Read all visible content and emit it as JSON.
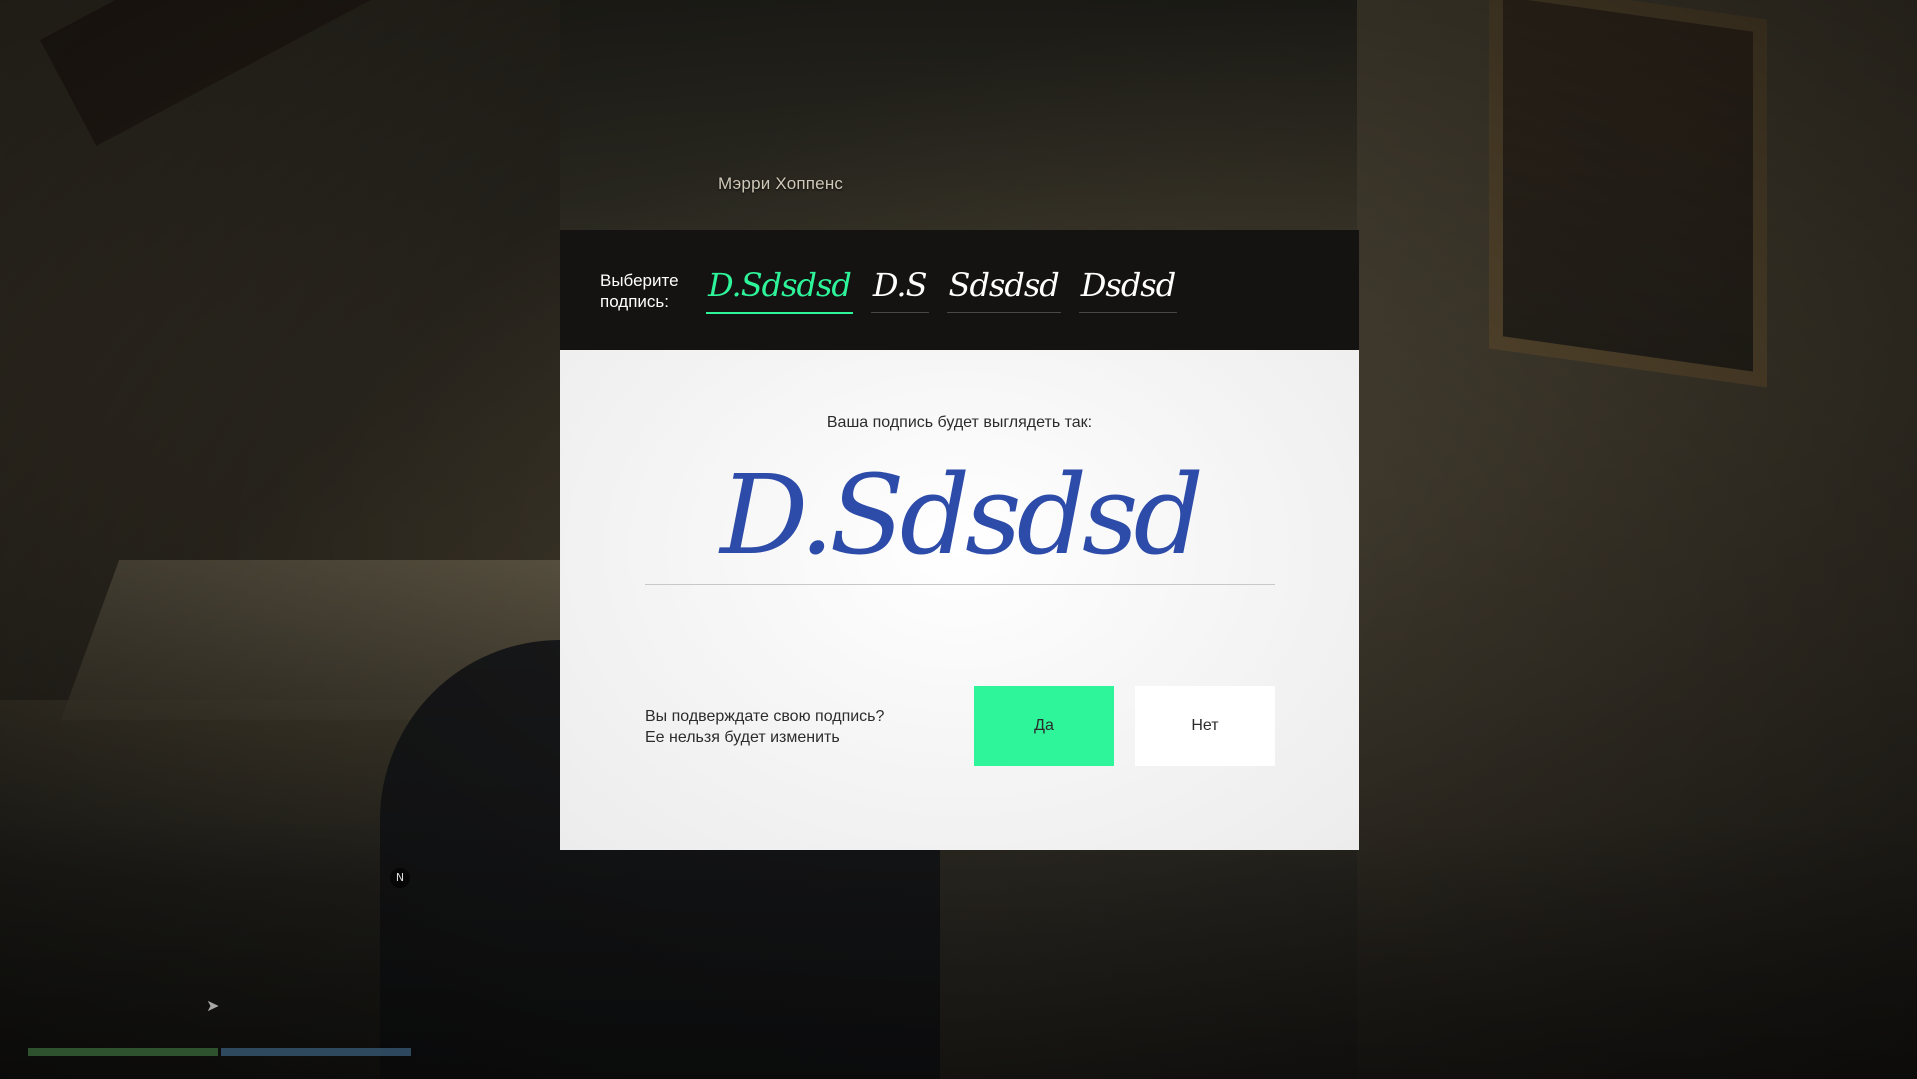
{
  "npc": {
    "name": "Мэрри Хоппенс"
  },
  "modal": {
    "choose_label": "Выберите подпись:",
    "options": [
      {
        "text": "D.Sdsdsd",
        "active": true
      },
      {
        "text": "D.S",
        "active": false
      },
      {
        "text": "Sdsdsd",
        "active": false
      },
      {
        "text": "Dsdsd",
        "active": false
      }
    ],
    "preview_caption": "Ваша подпись будет выглядеть так:",
    "preview_signature": "D.Sdsdsd",
    "confirm_line1": "Вы подверждате свою подпись?",
    "confirm_line2": "Ее нельзя будет изменить",
    "yes_label": "Да",
    "no_label": "Нет"
  },
  "hud": {
    "north_label": "N"
  },
  "colors": {
    "accent": "#2ef59a",
    "signature_ink": "#2d4ba8",
    "header_bg": "#141311"
  }
}
